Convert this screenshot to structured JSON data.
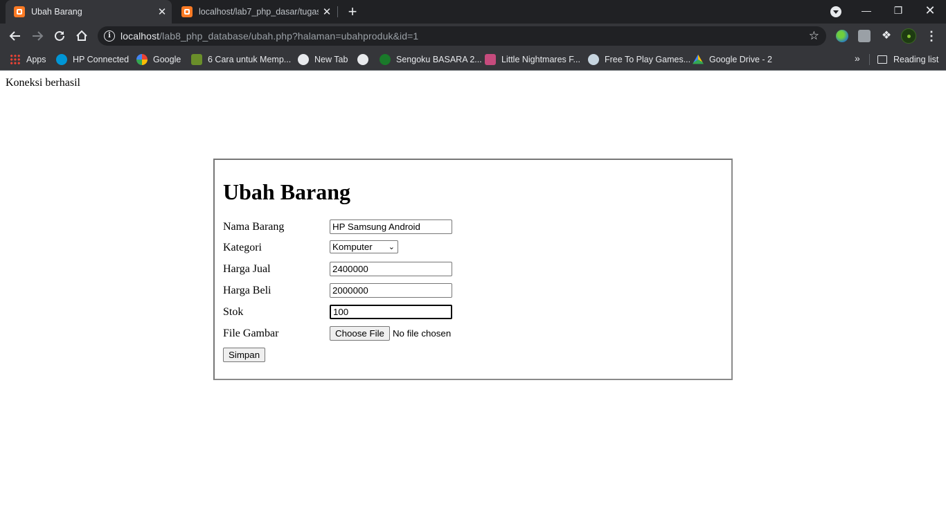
{
  "browser": {
    "tabs": [
      {
        "title": "Ubah Barang",
        "active": true
      },
      {
        "title": "localhost/lab7_php_dasar/tugas.php",
        "active": false
      }
    ],
    "new_tab_label": "+",
    "address": {
      "host": "localhost",
      "path": "/lab8_php_database/ubah.php?halaman=ubahproduk&id=1"
    },
    "bookmarks": [
      {
        "label": "Apps",
        "icon": "apps-grid-icon"
      },
      {
        "label": "HP Connected",
        "icon": "hp-icon"
      },
      {
        "label": "Google",
        "icon": "google-icon"
      },
      {
        "label": "6 Cara untuk Memp...",
        "icon": "wikihow-icon"
      },
      {
        "label": "New Tab",
        "icon": "globe-icon"
      },
      {
        "label": "",
        "icon": "globe-icon"
      },
      {
        "label": "Sengoku BASARA 2...",
        "icon": "sengoku-icon"
      },
      {
        "label": "Little Nightmares F...",
        "icon": "nightmares-icon"
      },
      {
        "label": "Free To Play Games...",
        "icon": "steam-icon"
      },
      {
        "label": "Google Drive - 2",
        "icon": "google-drive-icon"
      }
    ],
    "more_label": "»",
    "reading_list_label": "Reading list"
  },
  "page": {
    "status_text": "Koneksi berhasil",
    "form": {
      "title": "Ubah Barang",
      "nama_label": "Nama Barang",
      "nama_value": "HP Samsung Android",
      "kategori_label": "Kategori",
      "kategori_value": "Komputer",
      "harga_jual_label": "Harga Jual",
      "harga_jual_value": "2400000",
      "harga_beli_label": "Harga Beli",
      "harga_beli_value": "2000000",
      "stok_label": "Stok",
      "stok_value": "100",
      "file_label": "File Gambar",
      "file_button": "Choose File",
      "file_status": "No file chosen",
      "submit_label": "Simpan"
    }
  }
}
